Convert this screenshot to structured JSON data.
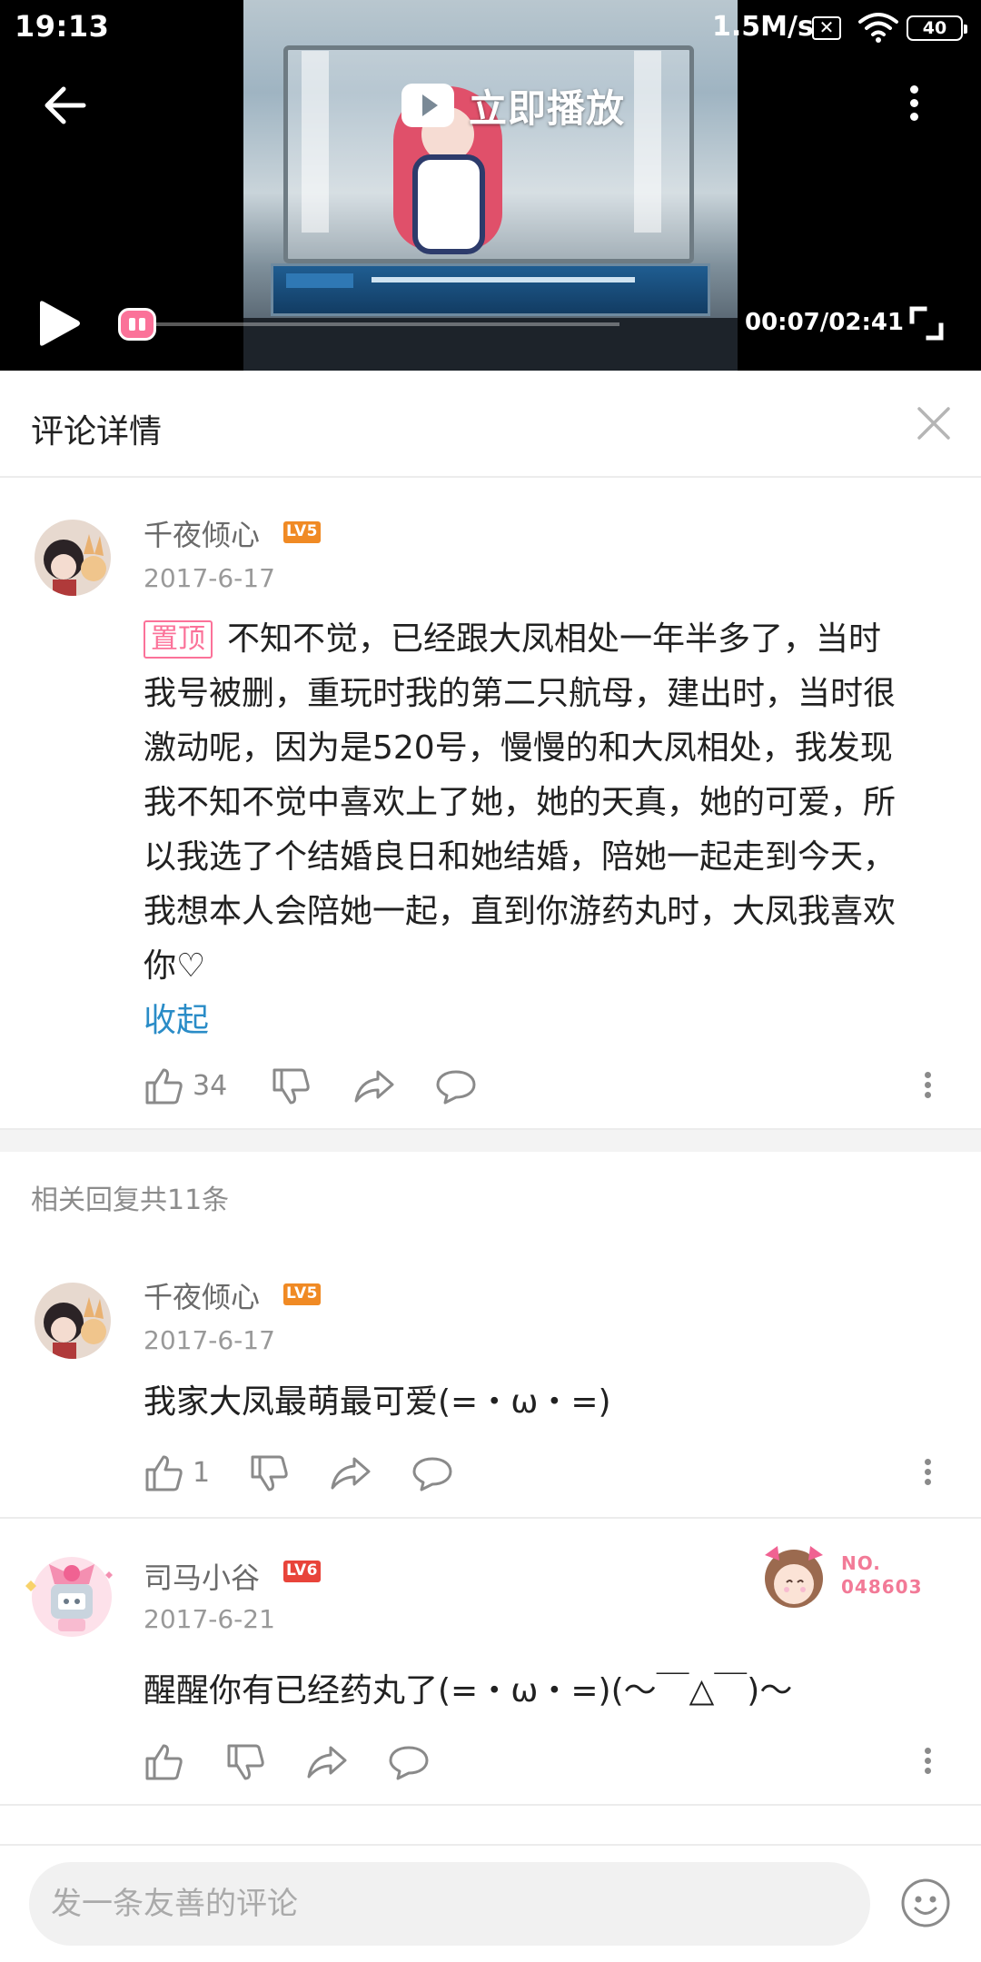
{
  "status_bar": {
    "time": "19:13",
    "network_speed": "1.5M/s",
    "battery": "40"
  },
  "player": {
    "play_now_label": "立即播放",
    "time_display": "00:07/02:41",
    "progress": 0.044,
    "accent_color": "#fb7299"
  },
  "comment_header": {
    "title": "评论详情"
  },
  "main_comment": {
    "username": "千夜倾心",
    "level": "LV5",
    "level_color": "#f08a24",
    "date": "2017-6-17",
    "pin_label": "置顶",
    "lines": [
      "不知不觉，已经跟大凤相处一年半多了，当时",
      "我号被删，重玩时我的第二只航母，建出时，当时很",
      "激动呢，因为是520号，慢慢的和大凤相处，我发现",
      "我不知不觉中喜欢上了她，她的天真，她的可爱，所",
      "以我选了个结婚良日和她结婚，陪她一起走到今天，",
      "我想本人会陪她一起，直到你游药丸时，大凤我喜欢",
      "你♡"
    ],
    "collapse_label": "收起",
    "like_count": "34"
  },
  "replies": {
    "title": "相关回复共11条",
    "items": [
      {
        "username": "千夜倾心",
        "level": "LV5",
        "level_color": "#f08a24",
        "date": "2017-6-17",
        "content": "我家大凤最萌最可爱(=・ω・=)",
        "like_count": "1"
      },
      {
        "username": "司马小谷",
        "level": "LV6",
        "level_color": "#e8443a",
        "date": "2017-6-21",
        "content": "醒醒你有已经药丸了(=・ω・=)(〜￣△￣)〜",
        "fan_badge_line1": "NO.",
        "fan_badge_line2": "048603"
      }
    ]
  },
  "input_bar": {
    "placeholder": "发一条友善的评论"
  },
  "icons": {
    "like": "thumb-up-icon",
    "dislike": "thumb-down-icon",
    "share": "share-icon",
    "reply": "comment-bubble-icon",
    "more": "more-vertical-icon",
    "close": "close-icon",
    "emoji": "emoji-icon"
  }
}
